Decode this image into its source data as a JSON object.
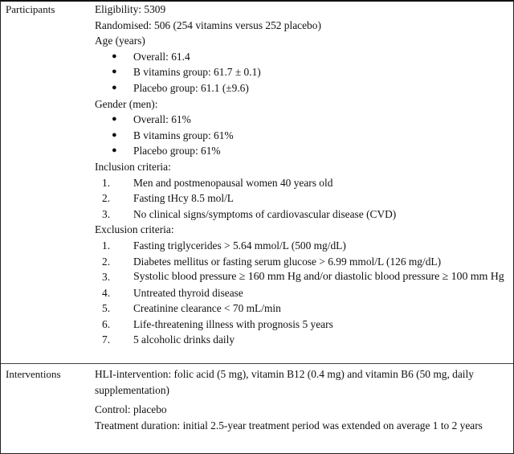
{
  "table": {
    "rows": [
      {
        "label": "Participants",
        "eligibility": "Eligibility: 5309",
        "randomised": "Randomised: 506 (254 vitamins versus 252  placebo)",
        "age": {
          "heading": "Age (years)",
          "items": [
            "Overall: 61.4",
            "B vitamins group: 61.7  ± 0.1)",
            "Placebo group: 61.1 (±9.6)"
          ]
        },
        "gender": {
          "heading": "Gender (men):",
          "items": [
            "Overall: 61%",
            "B vitamins group: 61%",
            "Placebo group: 61%"
          ]
        },
        "inclusion": {
          "heading": "Inclusion criteria:",
          "items": [
            "Men and postmenopausal women 40 years old",
            "Fasting tHcy 8.5 mol/L",
            "No clinical signs/symptoms of cardiovascular disease (CVD)"
          ]
        },
        "exclusion": {
          "heading": "Exclusion criteria:",
          "items": [
            "Fasting triglycerides > 5.64 mmol/L (500 mg/dL)",
            "Diabetes mellitus or fasting serum glucose > 6.99 mmol/L (126 mg/dL)",
            "Systolic blood pressure ≥ 160 mm Hg and/or diastolic blood pressure ≥ 100 mm Hg",
            "Untreated thyroid disease",
            "Creatinine clearance < 70 mL/min",
            "Life-threatening illness with prognosis 5 years",
            "5 alcoholic drinks daily"
          ]
        },
        "bullet_glyph": "●"
      },
      {
        "label": "Interventions",
        "lines": [
          "HLI-intervention: folic acid (5 mg), vitamin B12 (0.4 mg) and vitamin B6 (50 mg,  daily supplementation)",
          "Control: placebo",
          "Treatment duration: initial 2.5-year treatment period was extended on average  1 to 2 years"
        ]
      }
    ],
    "numbers": [
      "1.",
      "2.",
      "3.",
      "4.",
      "5.",
      "6.",
      "7."
    ]
  }
}
